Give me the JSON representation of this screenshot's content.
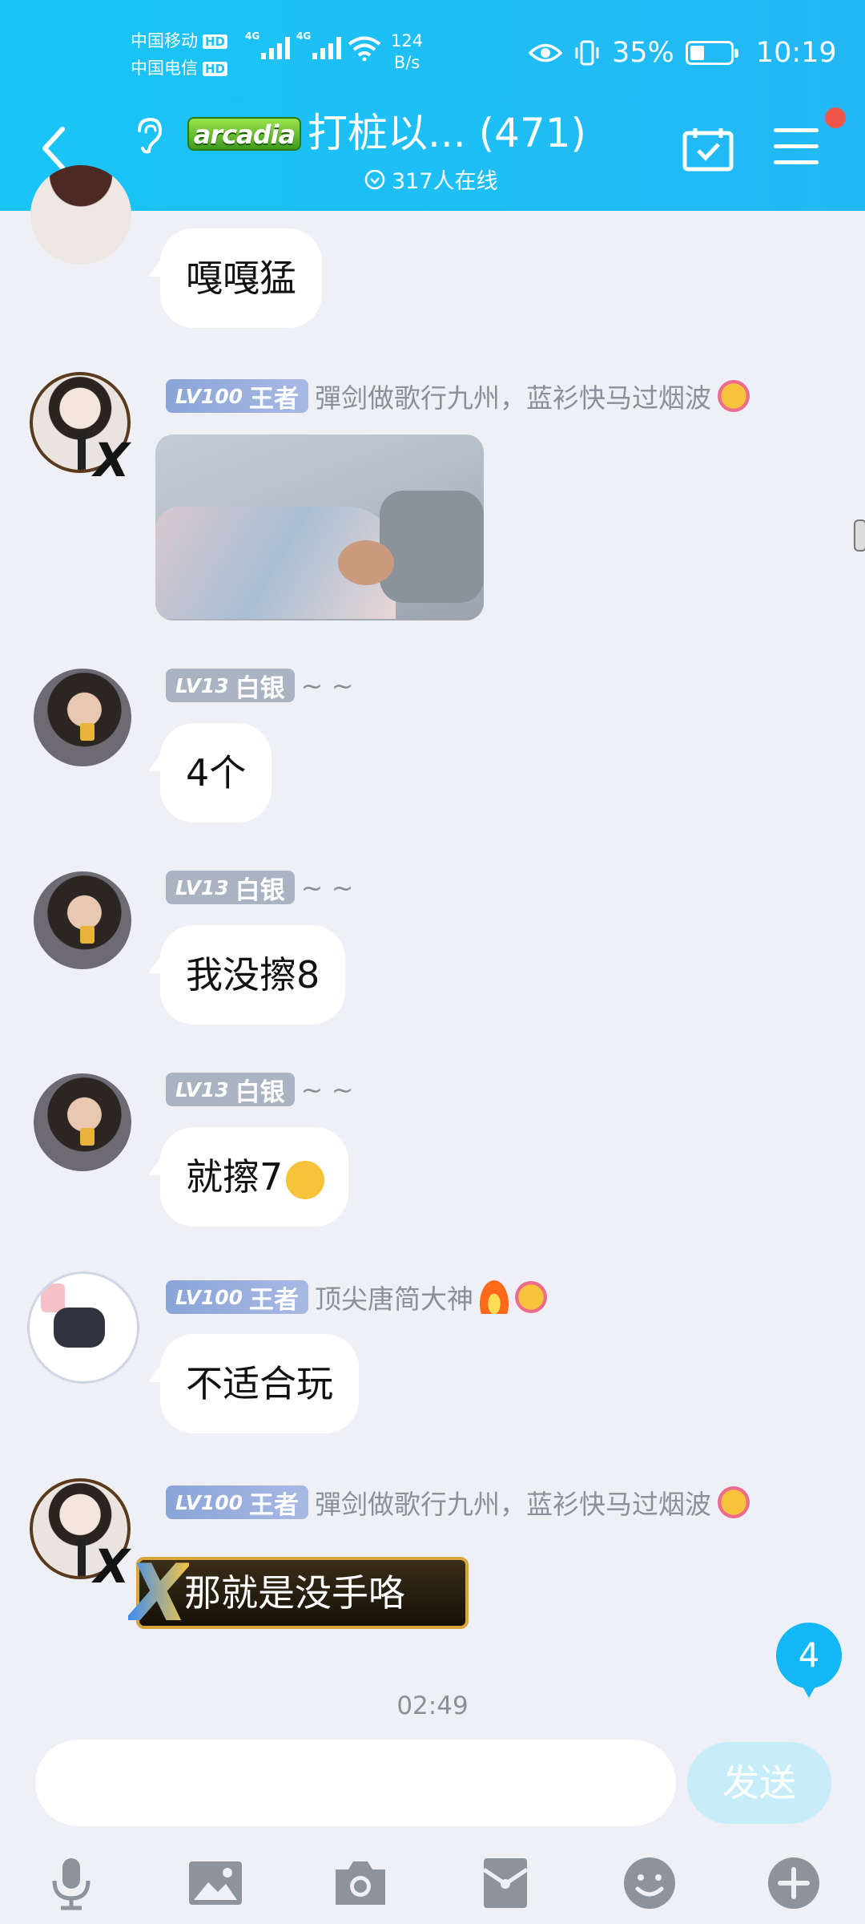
{
  "status_bar": {
    "carrier1": "中国移动",
    "carrier2": "中国电信",
    "hd_tag": "HD",
    "network_type": "4G",
    "speed_value": "124",
    "speed_unit": "B/s",
    "battery_percent": "35%",
    "battery_level": 0.35,
    "time": "10:19"
  },
  "header": {
    "game_logo": "arcadia",
    "group_title": "打桩以... (471)",
    "online_text": "317人在线"
  },
  "messages": [
    {
      "text": "嘎嘎猛"
    },
    {
      "level": "LV100",
      "title": "王者",
      "nickname": "彈剑做歌行九州，蓝衫快马过烟波",
      "type": "image"
    },
    {
      "level": "LV13",
      "title": "白银",
      "nickname": "~ ~",
      "text": "4个"
    },
    {
      "level": "LV13",
      "title": "白银",
      "nickname": "~ ~",
      "text": "我没擦8"
    },
    {
      "level": "LV13",
      "title": "白银",
      "nickname": "~ ~",
      "text": "就擦7"
    },
    {
      "level": "LV100",
      "title": "王者",
      "nickname": "顶尖唐简大神",
      "text": "不适合玩"
    },
    {
      "level": "LV100",
      "title": "王者",
      "nickname": "彈剑做歌行九州，蓝衫快马过烟波",
      "text": "那就是没手咯"
    }
  ],
  "unread_count": "4",
  "timestamp": "02:49",
  "input": {
    "placeholder": "",
    "send_label": "发送"
  },
  "colors": {
    "header": "#1ebff5",
    "send_disabled": "#c7edfb",
    "unread_badge": "#12b7f5"
  }
}
